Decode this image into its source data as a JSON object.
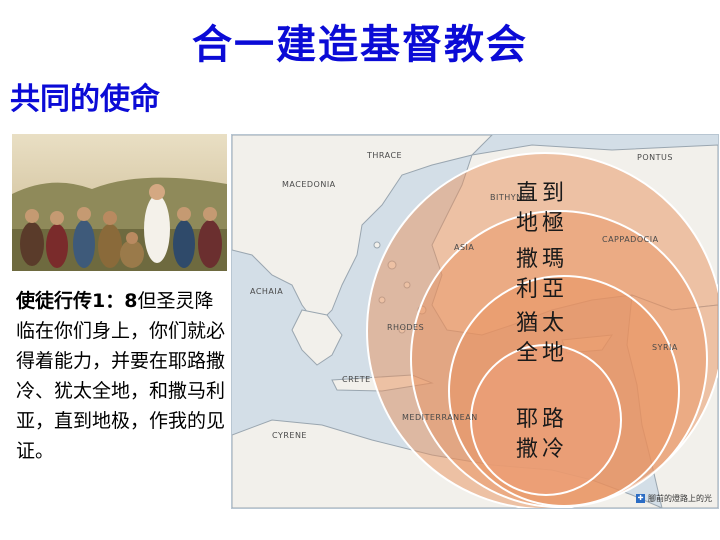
{
  "title": "合一建造基督教会",
  "subtitle": "共同的使命",
  "verse": {
    "reference": "使徒行传1：8",
    "text": "但圣灵降临在你们身上，你们就必得着能力，并要在耶路撒冷、犹太全地，和撒马利亚，直到地极，作我的见证。"
  },
  "map": {
    "circles": [
      {
        "label_line1": "直到",
        "label_line2": "地極"
      },
      {
        "label_line1": "撒瑪",
        "label_line2": "利亞"
      },
      {
        "label_line1": "猶太",
        "label_line2": "全地"
      },
      {
        "label_line1": "耶路",
        "label_line2": "撒冷"
      }
    ],
    "region_labels": {
      "thrace": "THRACE",
      "pontus": "PONTUS",
      "macedonia": "MACEDONIA",
      "achaia": "ACHAIA",
      "asia": "ASIA",
      "bithynia": "BITHYNIA",
      "cappadocia": "CAPPADOCIA",
      "rhodes": "RHODES",
      "syria": "SYRIA",
      "crete": "CRETE",
      "cyrene": "CYRENE",
      "mediterranean": "MEDITERRANEAN"
    },
    "watermark": "腳前的燈路上的光",
    "colors": {
      "sea": "#d3dee7",
      "land": "#f2f0eb",
      "circle": "#e8915e"
    }
  }
}
